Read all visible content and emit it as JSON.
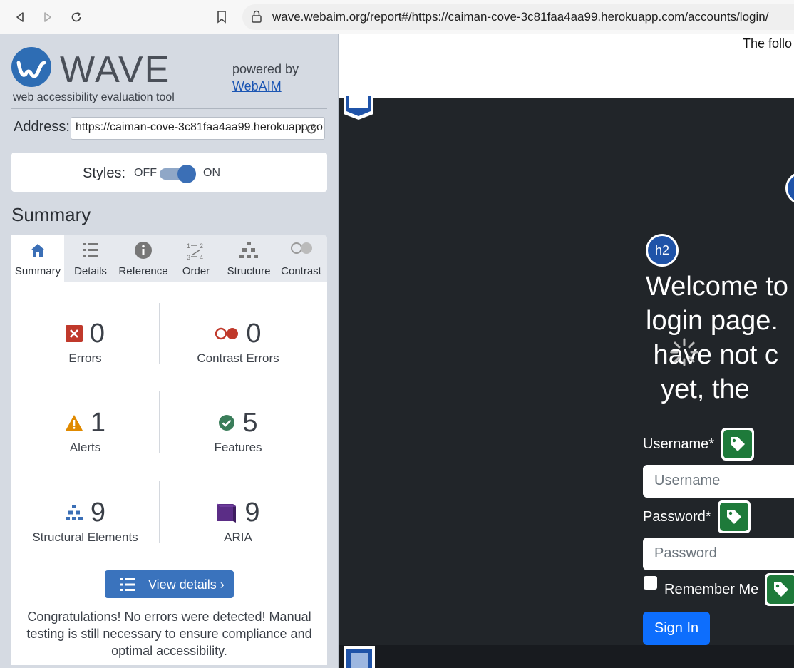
{
  "browser": {
    "url": "wave.webaim.org/report#/https://caiman-cove-3c81faa4aa99.herokuapp.com/accounts/login/"
  },
  "wave": {
    "logo_text": "WAVE",
    "tagline": "web accessibility evaluation tool",
    "powered_by": "powered by",
    "webaim_link": "WebAIM",
    "address_label": "Address:",
    "address_value": "https://caiman-cove-3c81faa4aa99.herokuapp.com/accounts/login/",
    "styles_label": "Styles:",
    "styles_off": "OFF",
    "styles_on": "ON",
    "summary_heading": "Summary",
    "tabs": [
      {
        "label": "Summary",
        "icon": "home-icon"
      },
      {
        "label": "Details",
        "icon": "list-icon"
      },
      {
        "label": "Reference",
        "icon": "info-icon"
      },
      {
        "label": "Order",
        "icon": "order-icon"
      },
      {
        "label": "Structure",
        "icon": "structure-icon"
      },
      {
        "label": "Contrast",
        "icon": "contrast-icon"
      }
    ],
    "stats": {
      "errors": {
        "value": "0",
        "label": "Errors"
      },
      "contrast_errors": {
        "value": "0",
        "label": "Contrast Errors"
      },
      "alerts": {
        "value": "1",
        "label": "Alerts"
      },
      "features": {
        "value": "5",
        "label": "Features"
      },
      "structural": {
        "value": "9",
        "label": "Structural Elements"
      },
      "aria": {
        "value": "9",
        "label": "ARIA"
      }
    },
    "view_details": "View details ›",
    "congrats": "Congratulations! No errors were detected! Manual testing is still necessary to ensure compliance and optimal accessibility."
  },
  "preview": {
    "top_text": "The follo",
    "h2_badge": "h2",
    "welcome_lines": "Welcome to\nlogin page. \n have not c\n  yet, the",
    "username_label": "Username*",
    "username_placeholder": "Username",
    "password_label": "Password*",
    "password_placeholder": "Password",
    "remember_label": "Remember Me",
    "signin_label": "Sign In"
  },
  "colors": {
    "wave_blue": "#2e6db4",
    "error_red": "#c0392b",
    "alert_orange": "#e08a00",
    "feature_green": "#3a7d5a",
    "aria_purple": "#5b2d86",
    "signin_blue": "#0d6efd"
  }
}
